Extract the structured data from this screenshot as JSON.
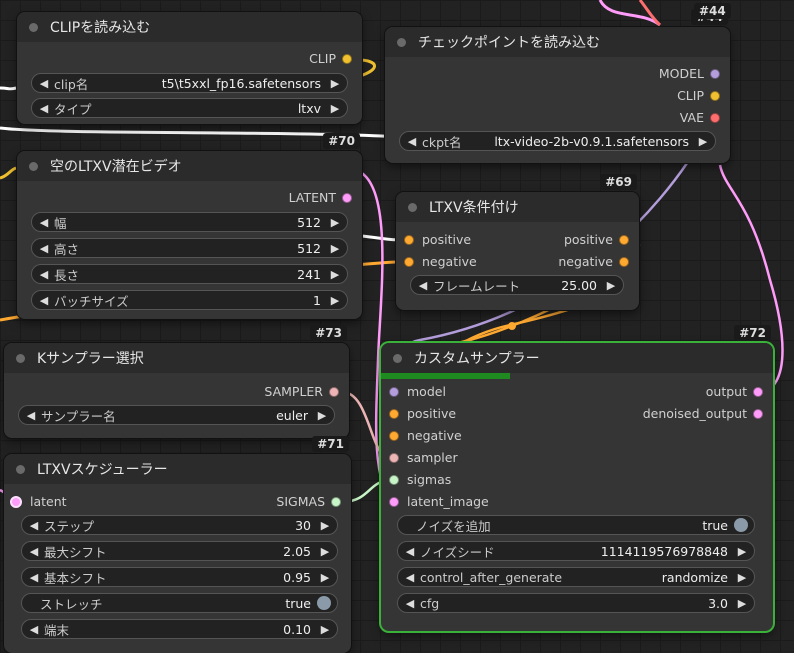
{
  "colors": {
    "clip": "#f0c030",
    "model": "#b39ddb",
    "vae": "#ff6e6e",
    "latent": "#ff9cf9",
    "conditioning": "#ffa931",
    "sampler": "#ecb4b4",
    "sigmas": "#c8f5c8",
    "selected": "#3ab23a"
  },
  "top_ids": {
    "n44": "#44"
  },
  "nodes": {
    "clip_loader": {
      "title": "CLIPを読み込む",
      "out_clip": "CLIP",
      "clip_name_label": "clip名",
      "clip_name_value": "t5\\t5xxl_fp16.safetensors",
      "type_label": "タイプ",
      "type_value": "ltxv"
    },
    "ckpt_loader": {
      "id": "#44",
      "title": "チェックポイントを読み込む",
      "out_model": "MODEL",
      "out_clip": "CLIP",
      "out_vae": "VAE",
      "ckpt_label": "ckpt名",
      "ckpt_value": "ltx-video-2b-v0.9.1.safetensors"
    },
    "empty_latent": {
      "id": "#70",
      "title": "空のLTXV潜在ビデオ",
      "out_latent": "LATENT",
      "width_label": "幅",
      "width_value": "512",
      "height_label": "高さ",
      "height_value": "512",
      "length_label": "長さ",
      "length_value": "241",
      "batch_label": "バッチサイズ",
      "batch_value": "1"
    },
    "ltxv_cond": {
      "id": "#69",
      "title": "LTXV条件付け",
      "in_positive": "positive",
      "in_negative": "negative",
      "out_positive": "positive",
      "out_negative": "negative",
      "fps_label": "フレームレート",
      "fps_value": "25.00"
    },
    "ksampler_select": {
      "id": "#73",
      "title": "Kサンプラー選択",
      "out_sampler": "SAMPLER",
      "sampler_label": "サンプラー名",
      "sampler_value": "euler"
    },
    "scheduler": {
      "id": "#71",
      "title": "LTXVスケジューラー",
      "in_latent": "latent",
      "out_sigmas": "SIGMAS",
      "steps_label": "ステップ",
      "steps_value": "30",
      "maxshift_label": "最大シフト",
      "maxshift_value": "2.05",
      "baseshift_label": "基本シフト",
      "baseshift_value": "0.95",
      "stretch_label": "ストレッチ",
      "stretch_value": "true",
      "terminal_label": "端末",
      "terminal_value": "0.10"
    },
    "custom_sampler": {
      "id": "#72",
      "title": "カスタムサンプラー",
      "progress": 0.33,
      "in_model": "model",
      "in_positive": "positive",
      "in_negative": "negative",
      "in_sampler": "sampler",
      "in_sigmas": "sigmas",
      "in_latent_image": "latent_image",
      "out_output": "output",
      "out_denoised": "denoised_output",
      "noise_label": "ノイズを追加",
      "noise_value": "true",
      "seed_label": "ノイズシード",
      "seed_value": "1114119576978848",
      "cag_label": "control_after_generate",
      "cag_value": "randomize",
      "cfg_label": "cfg",
      "cfg_value": "3.0"
    }
  }
}
